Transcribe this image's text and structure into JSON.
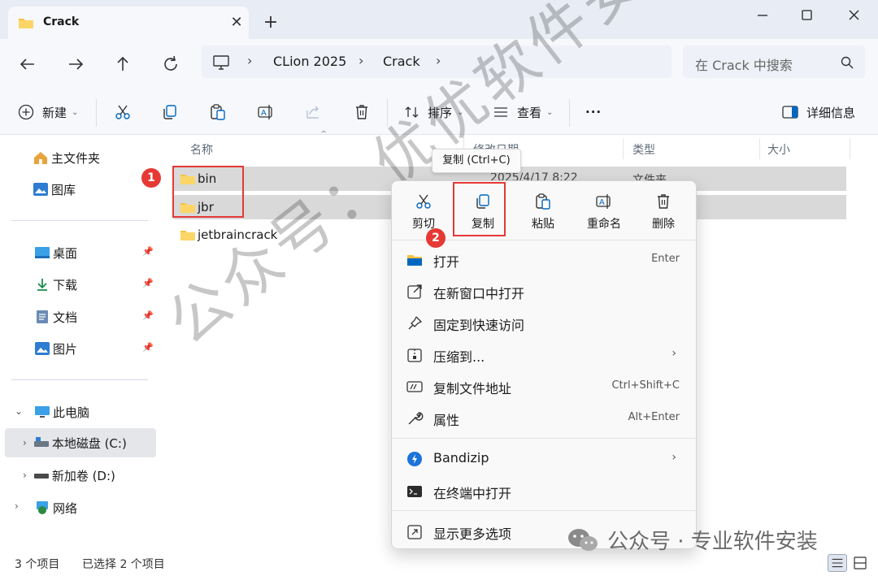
{
  "window": {
    "tab_title": "Crack",
    "new_tab": "+"
  },
  "address": {
    "crumbs": [
      "CLion 2025",
      "Crack"
    ],
    "search_placeholder": "在 Crack 中搜索"
  },
  "toolbar": {
    "new_label": "新建",
    "sort_label": "排序",
    "view_label": "查看",
    "more_label": "···",
    "details_label": "详细信息"
  },
  "sidebar": {
    "home": "主文件夹",
    "gallery": "图库",
    "desktop": "桌面",
    "downloads": "下载",
    "documents": "文档",
    "pictures": "图片",
    "this_pc": "此电脑",
    "drive_c": "本地磁盘 (C:)",
    "drive_d": "新加卷 (D:)",
    "network": "网络"
  },
  "filelist": {
    "columns": [
      "名称",
      "修改日期",
      "类型",
      "大小"
    ],
    "rows": [
      {
        "name": "bin",
        "date": "2025/4/17 8:22",
        "type": "文件夹",
        "selected": true
      },
      {
        "name": "jbr",
        "date": "",
        "type": "",
        "selected": true
      },
      {
        "name": "jetbraincrack",
        "date": "",
        "type": "",
        "selected": false
      }
    ]
  },
  "status": {
    "count": "3 个项目",
    "selected": "已选择 2 个项目"
  },
  "tooltip": "复制 (Ctrl+C)",
  "context_menu": {
    "quick": [
      "剪切",
      "复制",
      "粘贴",
      "重命名",
      "删除"
    ],
    "items": [
      {
        "label": "打开",
        "shortcut": "Enter"
      },
      {
        "label": "在新窗口中打开",
        "shortcut": ""
      },
      {
        "label": "固定到快速访问",
        "shortcut": ""
      },
      {
        "label": "压缩到...",
        "shortcut": ""
      },
      {
        "label": "复制文件地址",
        "shortcut": "Ctrl+Shift+C"
      },
      {
        "label": "属性",
        "shortcut": "Alt+Enter"
      },
      {
        "label": "Bandizip",
        "shortcut": ""
      },
      {
        "label": "在终端中打开",
        "shortcut": ""
      },
      {
        "label": "显示更多选项",
        "shortcut": ""
      }
    ]
  },
  "annotations": {
    "badge_1": "1",
    "badge_2": "2"
  },
  "watermark": {
    "diagonal": "公众号：优优软件安装",
    "bottom": "公众号 · 专业软件安装"
  },
  "colors": {
    "accent": "#0067c0",
    "folder": "#f7c144",
    "highlight": "#e53935",
    "selection": "#d9d9d9"
  }
}
